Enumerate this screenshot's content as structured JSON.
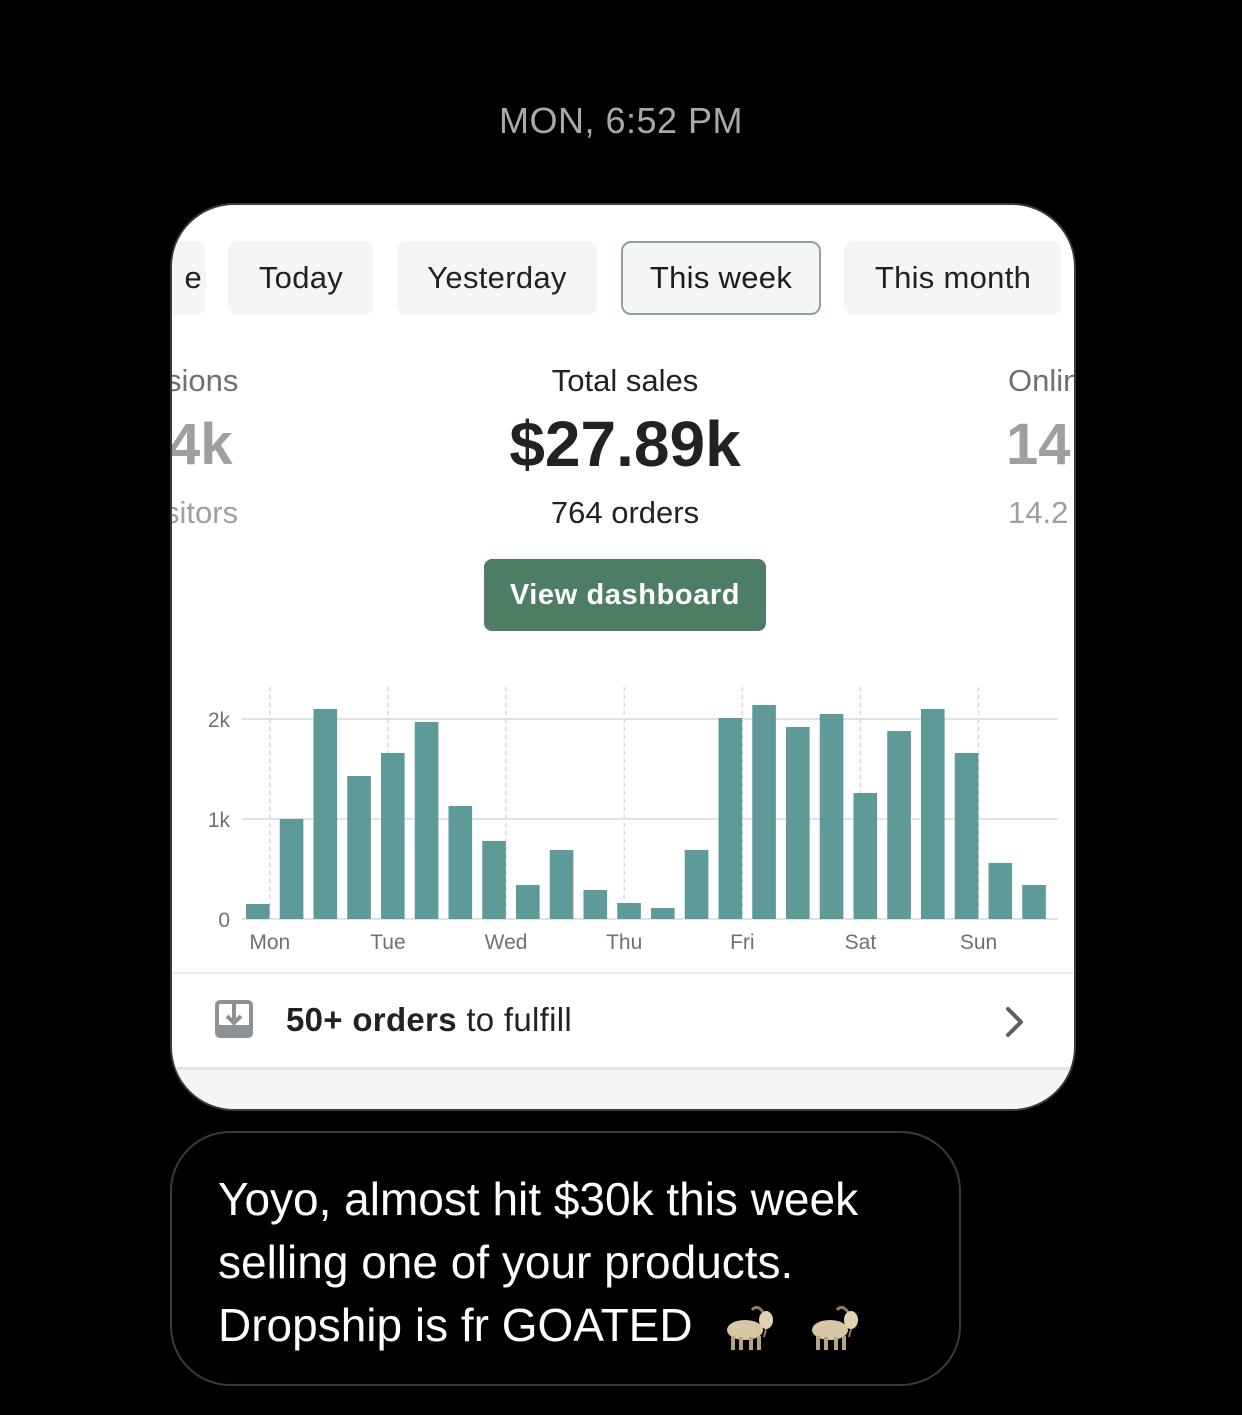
{
  "timestamp": "MON, 6:52 PM",
  "tabs": [
    {
      "label": "e",
      "active": false
    },
    {
      "label": "Today",
      "active": false
    },
    {
      "label": "Yesterday",
      "active": false
    },
    {
      "label": "This week",
      "active": true
    },
    {
      "label": "This month",
      "active": false
    }
  ],
  "metrics": {
    "left": {
      "label": "sions",
      "value": "4k",
      "sub": "sitors"
    },
    "center": {
      "label": "Total sales",
      "value": "$27.89k",
      "sub": "764 orders"
    },
    "right": {
      "label": "Onlin",
      "value": "14",
      "sub": "14.2"
    }
  },
  "dashboard_button": "View dashboard",
  "chart_data": {
    "type": "bar",
    "x_ticks": [
      "Mon",
      "Tue",
      "Wed",
      "Thu",
      "Fri",
      "Sat",
      "Sun"
    ],
    "y_ticks": [
      "0",
      "1k",
      "2k"
    ],
    "ylim": [
      0,
      2000
    ],
    "values": [
      150,
      1000,
      2100,
      1430,
      1660,
      1970,
      1130,
      780,
      340,
      690,
      290,
      160,
      110,
      690,
      2010,
      2140,
      1920,
      2050,
      1260,
      1880,
      2100,
      1660,
      560,
      340
    ],
    "bar_color": "#5e9b98",
    "grid": true
  },
  "fulfill": {
    "count": "50+ orders",
    "suffix": " to fulfill"
  },
  "message": {
    "lines": [
      "Yoyo, almost hit $30k this week",
      "selling one of your products.",
      "Dropship is fr GOATED"
    ],
    "emoji": "goat-icon"
  },
  "colors": {
    "accent": "#4e7d66",
    "bar": "#5e9b98",
    "background": "#000000"
  }
}
